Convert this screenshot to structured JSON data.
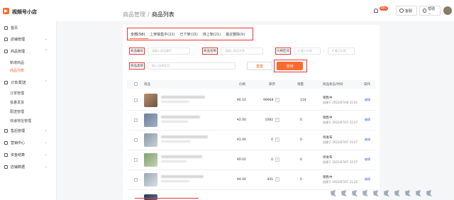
{
  "app": {
    "brand": "视频号小店"
  },
  "breadcrumb": {
    "parent": "商品管理",
    "sep": "/",
    "current": "商品列表"
  },
  "header": {
    "notice_badge": "99+",
    "service_label": "客服",
    "help_label": "帮助 ⌄"
  },
  "sidebar": {
    "items": [
      {
        "label": "首页"
      },
      {
        "label": "店铺管理"
      },
      {
        "label": "商品管理"
      },
      {
        "label": "订单/配送"
      },
      {
        "label": "售后管理"
      },
      {
        "label": "营销中心"
      },
      {
        "label": "资金结算"
      },
      {
        "label": "店铺数据"
      }
    ],
    "sub_product": [
      {
        "label": "新增商品"
      },
      {
        "label": "商品列表"
      }
    ],
    "sub_order": [
      {
        "label": "订单管理"
      },
      {
        "label": "批量发货"
      },
      {
        "label": "配送管理"
      },
      {
        "label": "快递地址管理"
      }
    ]
  },
  "tabs": [
    {
      "label": "全部(58)"
    },
    {
      "label": "上架销售中(22)"
    },
    {
      "label": "已下架(15)"
    },
    {
      "label": "待上架(21)"
    },
    {
      "label": "最近删除(9)"
    }
  ],
  "filters": {
    "code_label": "商品编号",
    "code_placeholder": "请输入商品编号",
    "name_label": "商品名称",
    "name_placeholder": "请输入商品名称",
    "price_label": "价格区间",
    "price_min_placeholder": "¥ 最小价格",
    "price_dash": "-",
    "price_max_placeholder": "¥ 最大价格",
    "brand_label": "商品类目",
    "brand_placeholder": "输入/选择类目",
    "reset_label": "重置",
    "query_label": "查询"
  },
  "table": {
    "headers": {
      "product": "商品",
      "price": "价格",
      "stock": "库存",
      "sales": "销量",
      "status": "商品状态/时间",
      "op": "操作"
    },
    "rows": [
      {
        "price": "¥0.10",
        "stock": "99968",
        "sales": "134",
        "status": "销售中",
        "time": "创建于 2022/07/08 15:01",
        "op": "编辑"
      },
      {
        "price": "¥2.00",
        "stock": "1082",
        "sales": "0",
        "status": "销售中",
        "time": "创建于 2022/07/07 21:07",
        "op": "编辑"
      },
      {
        "price": "¥1.00",
        "stock": "0",
        "sales": "0",
        "status": "待发布",
        "time": "创建于 2022/07/07 21:07",
        "op": "编辑"
      },
      {
        "price": "¥0.02",
        "stock": "0",
        "sales": "0",
        "status": "待发布",
        "time": "创建于 2022/07/07 21:07",
        "op": "编辑"
      },
      {
        "price": "¥4.00",
        "stock": "441",
        "sales": "0",
        "status": "销售中",
        "time": "创建于 2022/07/07 21:20",
        "op": "编辑"
      }
    ]
  },
  "colors": {
    "accent": "#fa6a2c",
    "highlight_box": "#e33",
    "link": "#3b6fd3"
  }
}
